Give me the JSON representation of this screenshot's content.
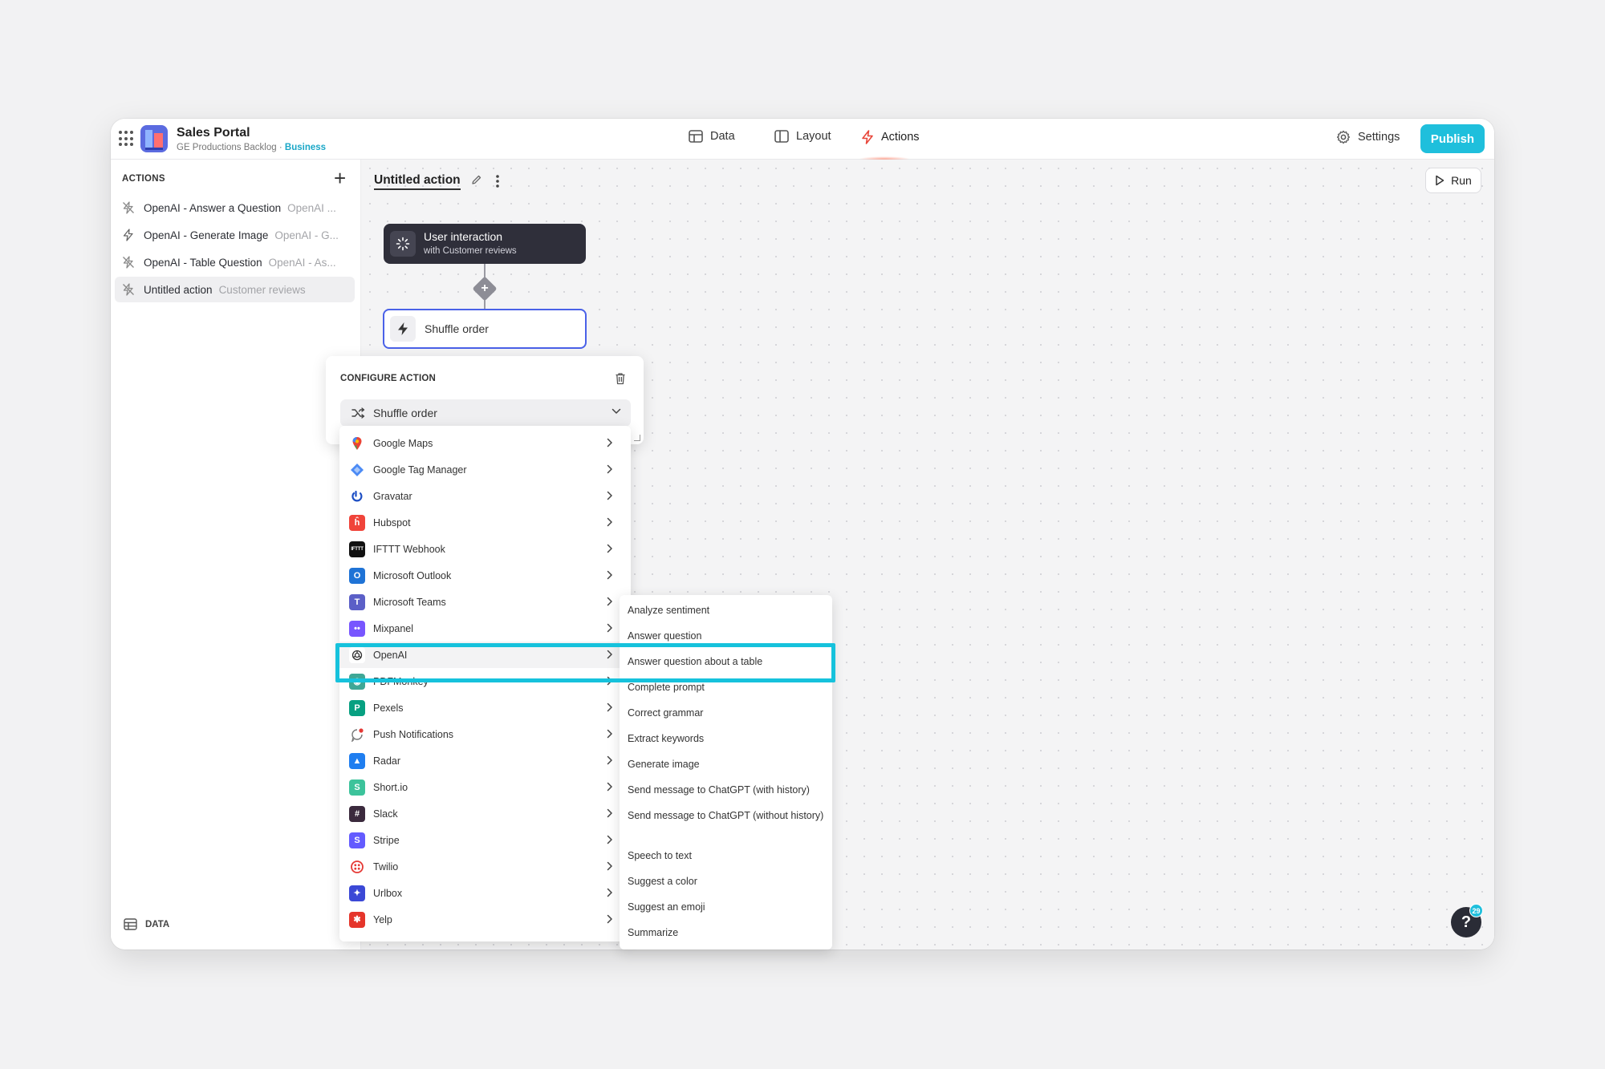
{
  "app": {
    "title": "Sales Portal",
    "subtitle": "GE Productions Backlog",
    "separator": "·",
    "plan": "Business"
  },
  "nav": {
    "tabs": [
      {
        "label": "Data"
      },
      {
        "label": "Layout"
      },
      {
        "label": "Actions"
      }
    ],
    "settings_label": "Settings",
    "publish_label": "Publish"
  },
  "sidebar": {
    "header": "ACTIONS",
    "add_symbol": "+",
    "items": [
      {
        "name": "OpenAI - Answer a Question",
        "sub": "OpenAI ...",
        "selected": false
      },
      {
        "name": "OpenAI - Generate Image",
        "sub": "OpenAI - G...",
        "selected": false
      },
      {
        "name": "OpenAI - Table Question",
        "sub": "OpenAI - As...",
        "selected": false
      },
      {
        "name": "Untitled action",
        "sub": "Customer reviews",
        "selected": true
      }
    ],
    "footer": "DATA"
  },
  "canvas": {
    "action_title": "Untitled action",
    "run_label": "Run",
    "trigger": {
      "title": "User interaction",
      "subtitle": "with Customer reviews"
    },
    "add_symbol": "+",
    "step": {
      "title": "Shuffle order"
    }
  },
  "configure": {
    "header": "CONFIGURE ACTION",
    "selected_action": "Shuffle order"
  },
  "integrations": [
    {
      "label": "Google Maps",
      "icon": "google-maps-icon",
      "color": "#ffffff"
    },
    {
      "label": "Google Tag Manager",
      "icon": "google-tag-manager-icon",
      "color": "#ffffff"
    },
    {
      "label": "Gravatar",
      "icon": "gravatar-icon",
      "color": "#ffffff"
    },
    {
      "label": "Hubspot",
      "icon": "hubspot-icon",
      "color": "#f0443a"
    },
    {
      "label": "IFTTT Webhook",
      "icon": "ifttt-icon",
      "color": "#111111"
    },
    {
      "label": "Microsoft Outlook",
      "icon": "outlook-icon",
      "color": "#1f73d6"
    },
    {
      "label": "Microsoft Teams",
      "icon": "teams-icon",
      "color": "#5b5fc7"
    },
    {
      "label": "Mixpanel",
      "icon": "mixpanel-icon",
      "color": "#7856ff"
    },
    {
      "label": "OpenAI",
      "icon": "openai-icon",
      "color": "#ffffff",
      "highlighted": true
    },
    {
      "label": "PDFMonkey",
      "icon": "pdfmonkey-icon",
      "color": "#3fa796"
    },
    {
      "label": "Pexels",
      "icon": "pexels-icon",
      "color": "#07a081"
    },
    {
      "label": "Push Notifications",
      "icon": "push-notifications-icon",
      "color": "#ffffff"
    },
    {
      "label": "Radar",
      "icon": "radar-icon",
      "color": "#1f7ef0"
    },
    {
      "label": "Short.io",
      "icon": "shortio-icon",
      "color": "#3cc39b"
    },
    {
      "label": "Slack",
      "icon": "slack-icon",
      "color": "#3b2a3d"
    },
    {
      "label": "Stripe",
      "icon": "stripe-icon",
      "color": "#635bff"
    },
    {
      "label": "Twilio",
      "icon": "twilio-icon",
      "color": "#ffffff"
    },
    {
      "label": "Urlbox",
      "icon": "urlbox-icon",
      "color": "#3b48d6"
    },
    {
      "label": "Yelp",
      "icon": "yelp-icon",
      "color": "#e5352b"
    }
  ],
  "openai_actions": [
    "Analyze sentiment",
    "Answer question",
    "Answer question about a table",
    "Complete prompt",
    "Correct grammar",
    "Extract keywords",
    "Generate image",
    "Send message to ChatGPT (with history)",
    "Send message to ChatGPT (without history)",
    "Speech to text",
    "Suggest a color",
    "Suggest an emoji",
    "Summarize"
  ],
  "help": {
    "label": "?",
    "badge": "29"
  },
  "colors": {
    "accent": "#1fbfdc",
    "highlight": "#16c2dc",
    "selected_node_border": "#4a61e8",
    "actions_tab": "#e8463a"
  }
}
